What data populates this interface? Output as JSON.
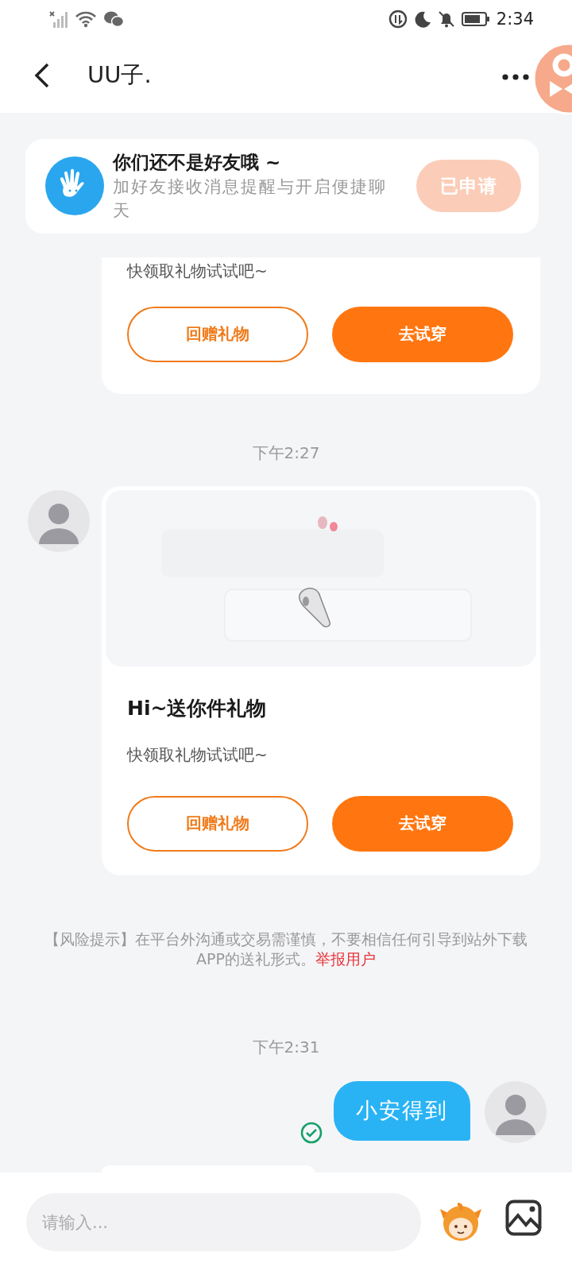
{
  "status_bar": {
    "time": "2:34"
  },
  "header": {
    "title": "UU子."
  },
  "friend_banner": {
    "title": "你们还不是好友哦 ~",
    "subtitle": "加好友接收消息提醒与开启便捷聊天",
    "button": {
      "label": "已申请",
      "disabled": true
    }
  },
  "messages": [
    {
      "kind": "gift",
      "subtitle": "快领取礼物试试吧~",
      "buttons": [
        {
          "label": "回赠礼物",
          "kind": "outline"
        },
        {
          "label": "去试穿",
          "kind": "filled"
        }
      ]
    },
    {
      "kind": "time",
      "text": "下午2:27"
    },
    {
      "kind": "gift",
      "title": "Hi~送你件礼物",
      "subtitle": "快领取礼物试试吧~",
      "buttons": [
        {
          "label": "回赠礼物",
          "kind": "outline"
        },
        {
          "label": "去试穿",
          "kind": "filled"
        }
      ]
    },
    {
      "kind": "notice",
      "text": "【风险提示】在平台外沟通或交易需谨慎，不要相信任何引导到站外下载APP的送礼形式。",
      "link": "举报用户"
    },
    {
      "kind": "time",
      "text": "下午2:31"
    },
    {
      "kind": "text",
      "text": "小安得到",
      "delivered": true
    },
    {
      "kind": "cut"
    }
  ],
  "input": {
    "placeholder": "请输入..."
  }
}
